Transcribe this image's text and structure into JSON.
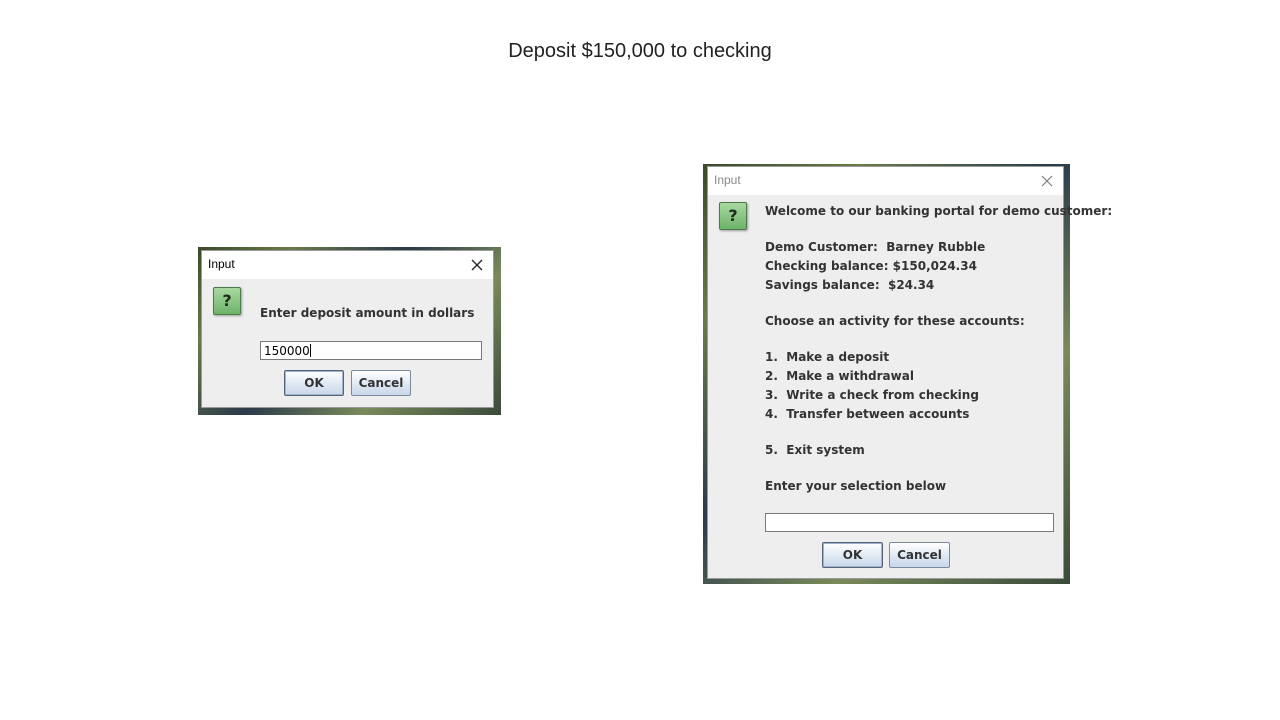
{
  "slide": {
    "title": "Deposit $150,000 to checking"
  },
  "deposit_dialog": {
    "title": "Input",
    "prompt": "Enter deposit amount in dollars",
    "input_value": "150000",
    "ok_label": "OK",
    "cancel_label": "Cancel"
  },
  "menu_dialog": {
    "title": "Input",
    "welcome": "Welcome to our banking portal for demo customer:",
    "customer_line": "Demo Customer:  Barney Rubble",
    "checking_line": "Checking balance: $150,024.34",
    "savings_line": "Savings balance:  $24.34",
    "choose_line": "Choose an activity for these accounts:",
    "options": [
      "1.  Make a deposit",
      "2.  Make a withdrawal",
      "3.  Write a check from checking",
      "4.  Transfer between accounts"
    ],
    "exit_option": "5.  Exit system",
    "selection_prompt": "Enter your selection below",
    "input_value": "",
    "ok_label": "OK",
    "cancel_label": "Cancel"
  },
  "icons": {
    "question": "question-icon",
    "close": "close-icon"
  },
  "question_glyph": "?"
}
